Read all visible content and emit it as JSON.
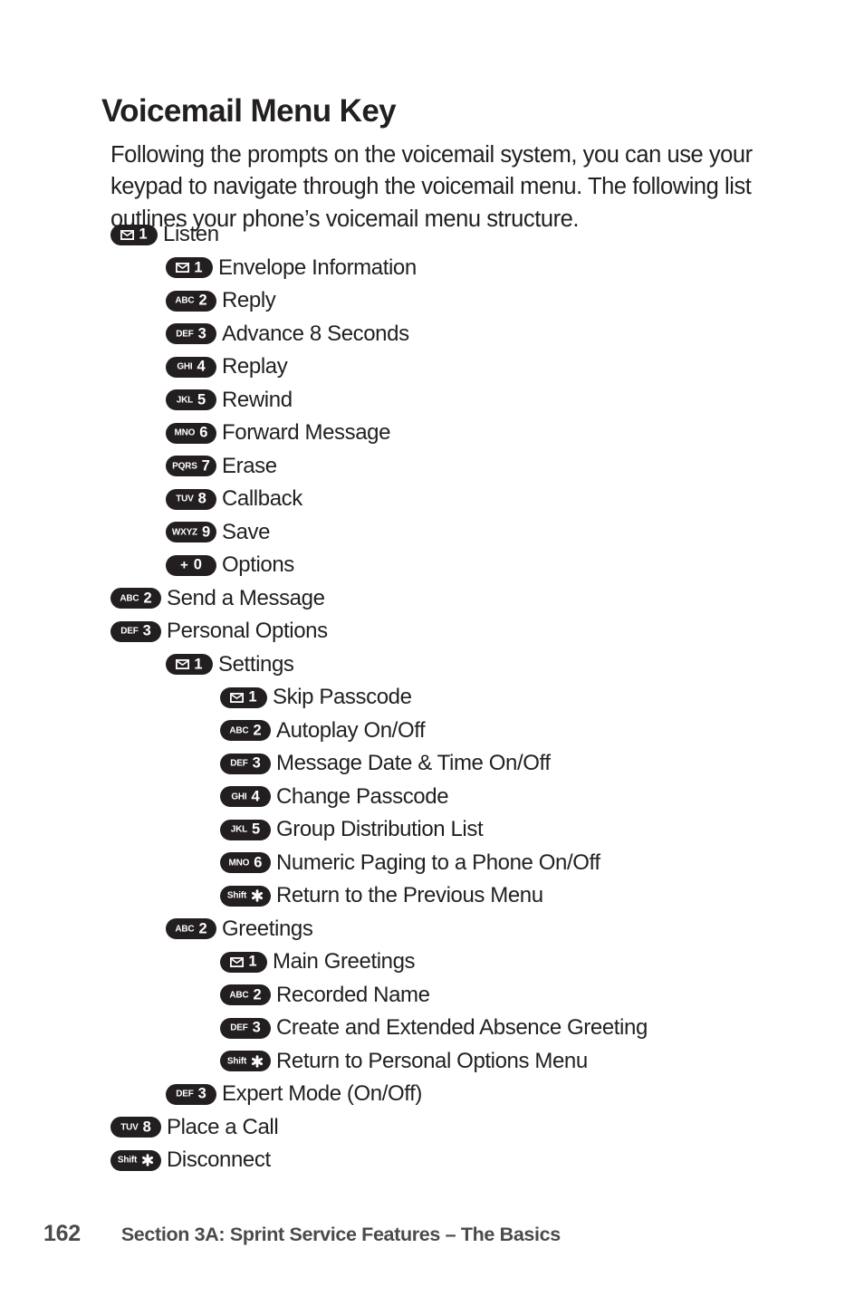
{
  "page": {
    "title": "Voicemail Menu Key",
    "intro": "Following the prompts on the voicemail system, you can use your keypad to navigate through the voicemail menu. The following list outlines your phone’s voicemail menu structure."
  },
  "colors": {
    "background": "#ffffff",
    "text": "#231f20",
    "keycap_background": "#231f20",
    "keycap_text": "#ffffff",
    "footer_text": "#4a4a4a"
  },
  "menu": [
    {
      "level": 1,
      "key_sub": "envelope-icon",
      "key_num": "1",
      "label": "Listen"
    },
    {
      "level": 2,
      "key_sub": "envelope-icon",
      "key_num": "1",
      "label": "Envelope Information"
    },
    {
      "level": 2,
      "key_sub": "ABC",
      "key_num": "2",
      "label": "Reply"
    },
    {
      "level": 2,
      "key_sub": "DEF",
      "key_num": "3",
      "label": "Advance 8 Seconds"
    },
    {
      "level": 2,
      "key_sub": "GHI",
      "key_num": "4",
      "label": "Replay"
    },
    {
      "level": 2,
      "key_sub": "JKL",
      "key_num": "5",
      "label": "Rewind"
    },
    {
      "level": 2,
      "key_sub": "MNO",
      "key_num": "6",
      "label": "Forward Message"
    },
    {
      "level": 2,
      "key_sub": "PQRS",
      "key_num": "7",
      "label": "Erase"
    },
    {
      "level": 2,
      "key_sub": "TUV",
      "key_num": "8",
      "label": "Callback"
    },
    {
      "level": 2,
      "key_sub": "WXYZ",
      "key_num": "9",
      "label": "Save"
    },
    {
      "level": 2,
      "key_sub": "plus-icon",
      "key_num": "0",
      "label": "Options"
    },
    {
      "level": 1,
      "key_sub": "ABC",
      "key_num": "2",
      "label": "Send a Message"
    },
    {
      "level": 1,
      "key_sub": "DEF",
      "key_num": "3",
      "label": "Personal Options"
    },
    {
      "level": 2,
      "key_sub": "envelope-icon",
      "key_num": "1",
      "label": "Settings"
    },
    {
      "level": 3,
      "key_sub": "envelope-icon",
      "key_num": "1",
      "label": "Skip Passcode"
    },
    {
      "level": 3,
      "key_sub": "ABC",
      "key_num": "2",
      "label": "Autoplay On/Off"
    },
    {
      "level": 3,
      "key_sub": "DEF",
      "key_num": "3",
      "label": "Message Date & Time On/Off"
    },
    {
      "level": 3,
      "key_sub": "GHI",
      "key_num": "4",
      "label": "Change Passcode"
    },
    {
      "level": 3,
      "key_sub": "JKL",
      "key_num": "5",
      "label": "Group Distribution List"
    },
    {
      "level": 3,
      "key_sub": "MNO",
      "key_num": "6",
      "label": "Numeric Paging to a Phone On/Off"
    },
    {
      "level": 3,
      "key_sub": "Shift",
      "key_num": "asterisk-icon",
      "label": "Return to the Previous Menu"
    },
    {
      "level": 2,
      "key_sub": "ABC",
      "key_num": "2",
      "label": "Greetings"
    },
    {
      "level": 3,
      "key_sub": "envelope-icon",
      "key_num": "1",
      "label": "Main Greetings"
    },
    {
      "level": 3,
      "key_sub": "ABC",
      "key_num": "2",
      "label": "Recorded Name"
    },
    {
      "level": 3,
      "key_sub": "DEF",
      "key_num": "3",
      "label": "Create and Extended Absence Greeting"
    },
    {
      "level": 3,
      "key_sub": "Shift",
      "key_num": "asterisk-icon",
      "label": "Return to Personal Options Menu"
    },
    {
      "level": 2,
      "key_sub": "DEF",
      "key_num": "3",
      "label": "Expert Mode (On/Off)"
    },
    {
      "level": 1,
      "key_sub": "TUV",
      "key_num": "8",
      "label": "Place a Call"
    },
    {
      "level": 1,
      "key_sub": "Shift",
      "key_num": "asterisk-icon",
      "label": "Disconnect"
    }
  ],
  "footer": {
    "page_number": "162",
    "section_title": "Section 3A: Sprint Service Features – The Basics"
  }
}
